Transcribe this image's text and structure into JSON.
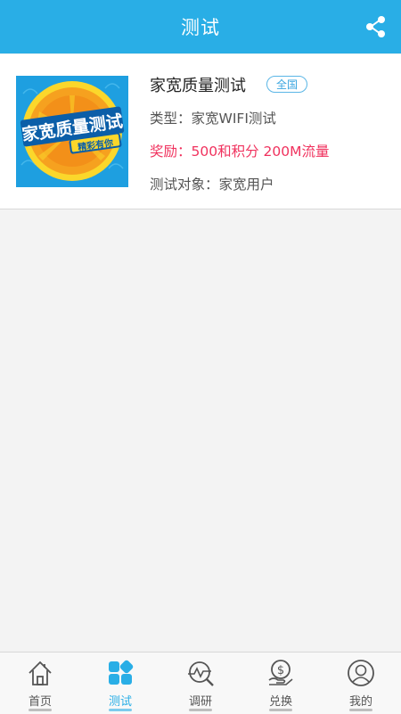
{
  "header": {
    "title": "测试",
    "share_icon": "share-icon"
  },
  "task": {
    "title": "家宽质量测试",
    "scope_tag": "全国",
    "type_line": "类型：家宽WIFI测试",
    "reward_line": "奖励：500和积分 200M流量",
    "target_line": "测试对象：家宽用户",
    "thumbnail": {
      "main_text": "家宽质量测试",
      "sub_text": "精彩有你"
    }
  },
  "tabbar": {
    "items": [
      {
        "label": "首页",
        "icon": "home-icon"
      },
      {
        "label": "测试",
        "icon": "grid-icon",
        "active": true
      },
      {
        "label": "调研",
        "icon": "research-icon"
      },
      {
        "label": "兑换",
        "icon": "exchange-icon"
      },
      {
        "label": "我的",
        "icon": "profile-icon"
      }
    ]
  },
  "colors": {
    "accent": "#29aee6",
    "reward": "#f0325e",
    "background": "#f3f3f3"
  }
}
